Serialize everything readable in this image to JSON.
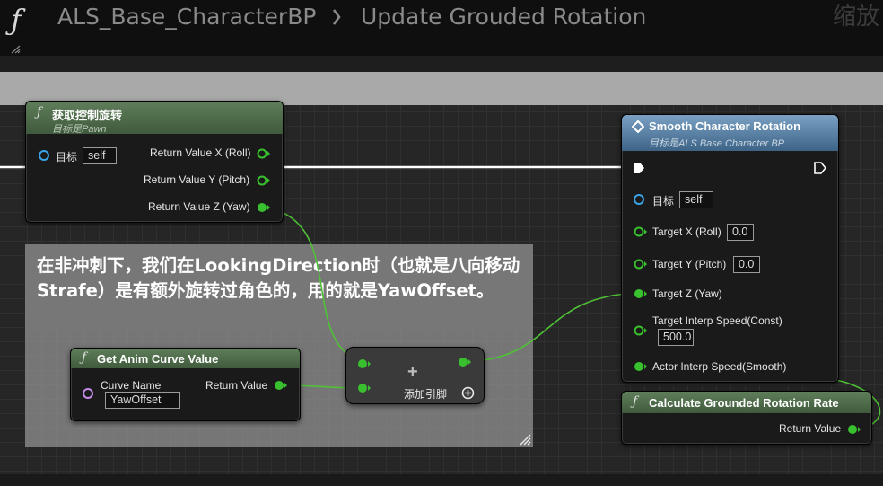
{
  "header": {
    "function_glyph": "ƒ",
    "blueprint": "ALS_Base_CharacterBP",
    "function_name": "Update Grouded Rotation",
    "zoom_label": "缩放"
  },
  "comment": {
    "text": "在非冲刺下，我们在LookingDirection时（也就是八向移动Strafe）是有额外旋转过角色的，用的就是YawOffset。"
  },
  "nodes": {
    "get_control_rotation": {
      "title": "获取控制旋转",
      "subtitle": "目标是Pawn",
      "target_label": "目标",
      "target_value": "self",
      "outputs": [
        "Return Value X (Roll)",
        "Return Value Y (Pitch)",
        "Return Value Z (Yaw)"
      ]
    },
    "smooth_character_rotation": {
      "title": "Smooth Character Rotation",
      "subtitle": "目标是ALS Base Character BP",
      "target_label": "目标",
      "target_value": "self",
      "target_x_label": "Target X (Roll)",
      "target_x_value": "0.0",
      "target_y_label": "Target Y (Pitch)",
      "target_y_value": "0.0",
      "target_z_label": "Target Z (Yaw)",
      "interp_label": "Target Interp Speed(Const)",
      "interp_value": "500.0",
      "actor_interp_label": "Actor Interp Speed(Smooth)"
    },
    "get_anim_curve_value": {
      "title": "Get Anim Curve Value",
      "curve_name_label": "Curve Name",
      "curve_name_value": "YawOffset",
      "return_label": "Return Value"
    },
    "add": {
      "symbol": "+",
      "add_pin_label": "添加引脚"
    },
    "calculate_grounded_rotation_rate": {
      "title": "Calculate Grounded Rotation Rate",
      "return_label": "Return Value"
    }
  },
  "colors": {
    "float_pin": "#39c02e",
    "object_pin": "#3aa3e8",
    "name_pin": "#c58be8",
    "exec_pin": "#ffffff",
    "function_header": "#4d6b49",
    "macro_header": "#5a83a8",
    "wire_green": "#55d43a",
    "wire_exec": "#ffffff"
  },
  "icons": [
    "function-icon",
    "chevron-right-icon",
    "grip-icon",
    "diamond-icon",
    "add-circle-icon"
  ]
}
